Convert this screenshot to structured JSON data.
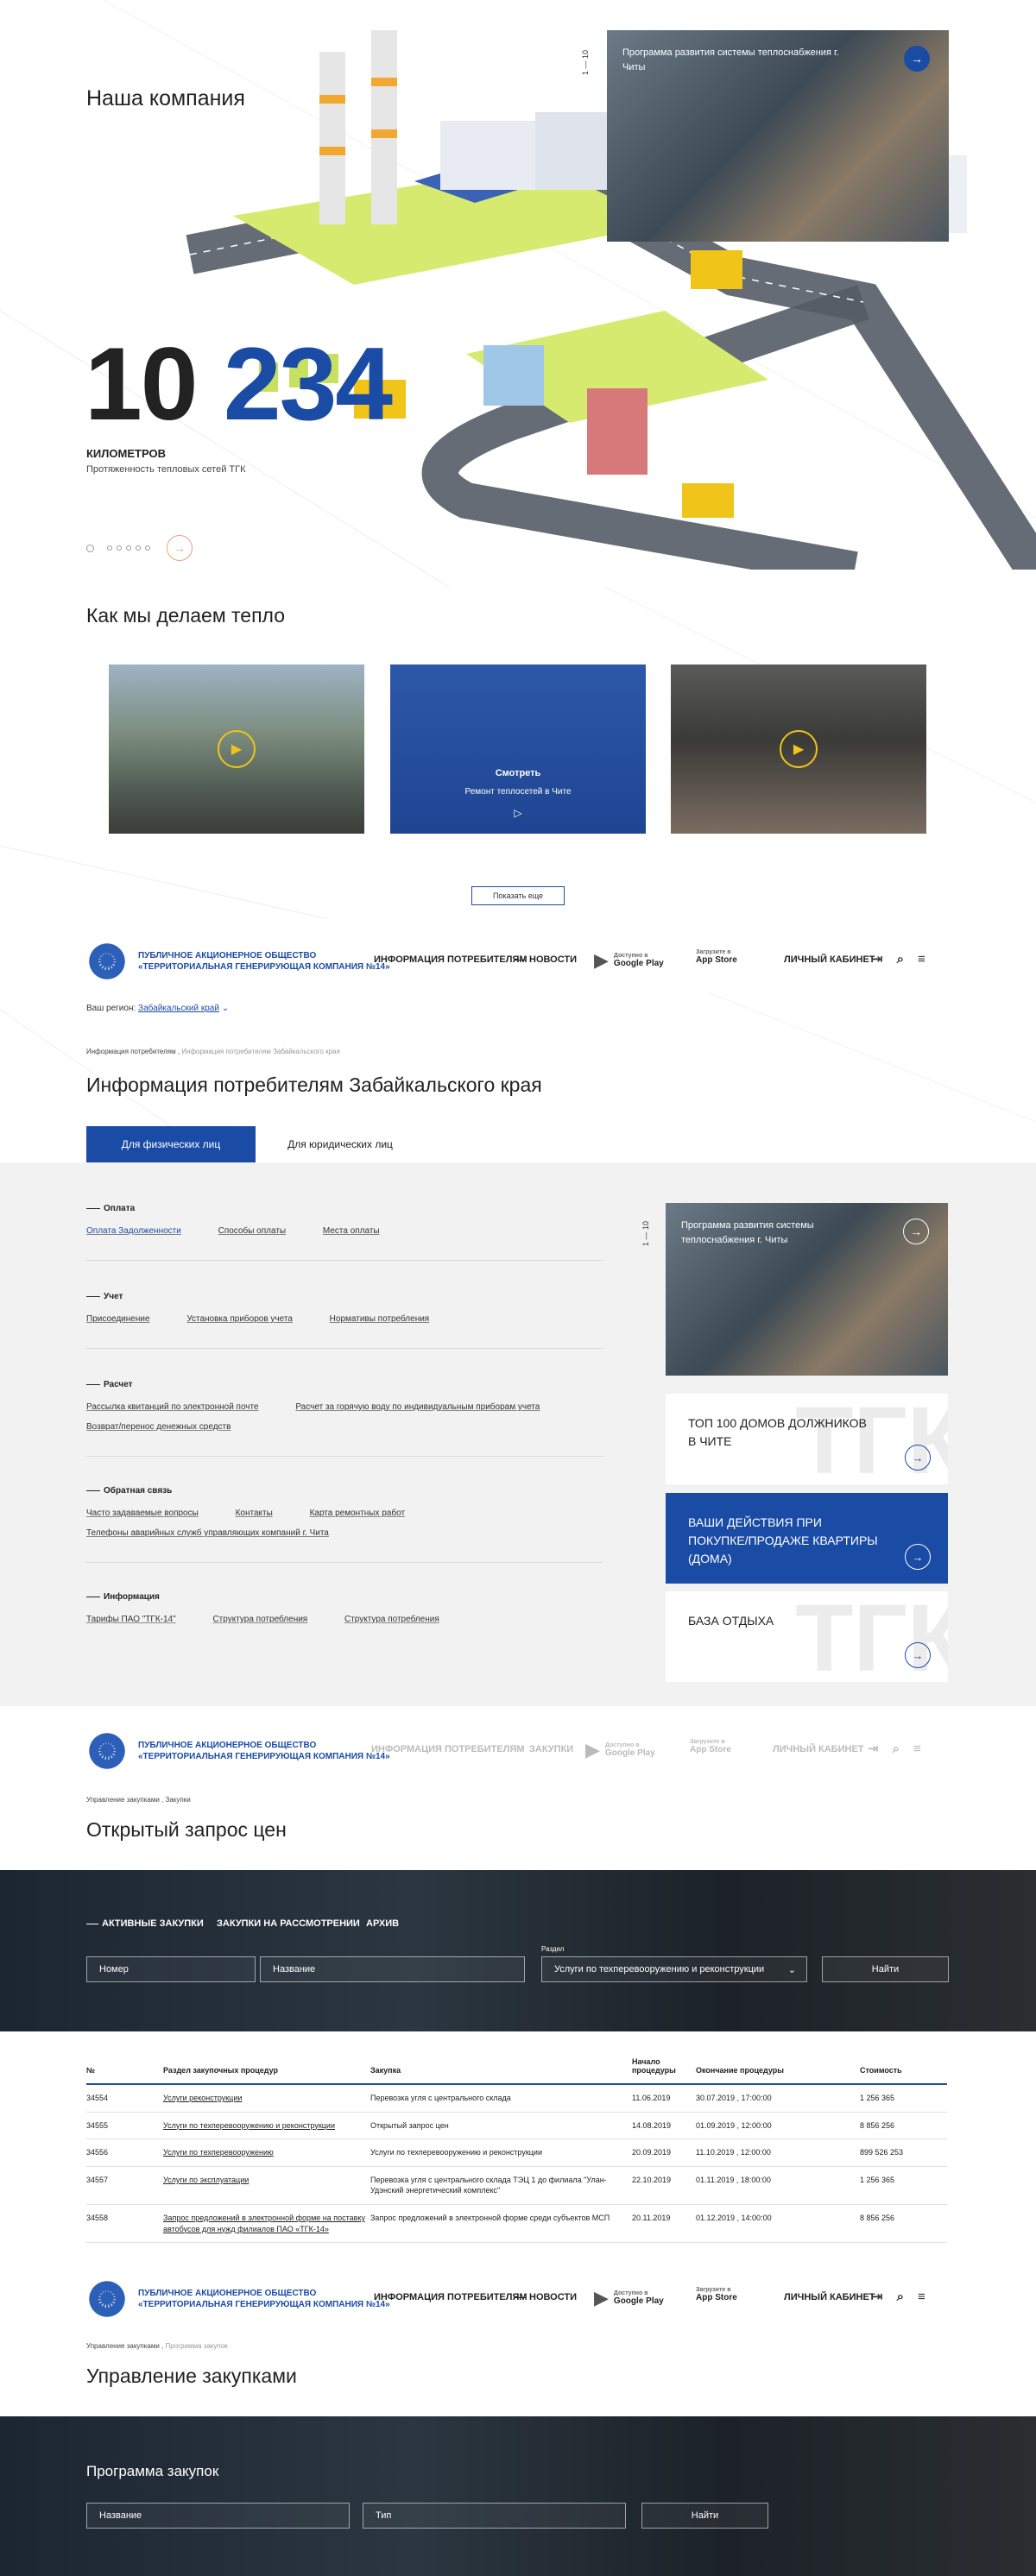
{
  "hero": {
    "title": "Наша компания",
    "number_a": "10",
    "number_b": "234",
    "unit": "КИЛОМЕТРОВ",
    "unit_sub": "Протяженность тепловых сетей ТГК",
    "pager": "1 — 10",
    "card_text": "Программа развития системы теплоснабжения г. Читы"
  },
  "heat": {
    "title": "Как мы делаем тепло",
    "video2_title": "Смотреть",
    "video2_sub": "Ремонт теплосетей в Чите",
    "more": "Показать еще"
  },
  "header": {
    "logo_line1": "ПУБЛИЧНОЕ АКЦИОНЕРНОЕ ОБЩЕСТВО",
    "logo_line2": "«ТЕРРИТОРИАЛЬНАЯ ГЕНЕРИРУЮЩАЯ КОМПАНИЯ №14»",
    "info": "ИНФОРМАЦИЯ ПОТРЕБИТЕЛЯМ",
    "news": "НОВОСТИ",
    "purchases": "ЗАКУПКИ",
    "gp_small": "Доступно в",
    "gp": "Google Play",
    "as_small": "Загрузите в",
    "as": "App Store",
    "cabinet": "ЛИЧНЫЙ КАБИНЕТ"
  },
  "consumers": {
    "region_label": "Ваш регион:",
    "region": "Забайкальский край",
    "crumb1": "Информация потребителям ,",
    "crumb2": "Информация потребителям Забайкальского края",
    "title": "Информация потребителям Забайкальского края",
    "tab_phys": "Для физических лиц",
    "tab_jur": "Для юридических лиц",
    "cat_pay": "Оплата",
    "pay_1": "Оплата Задолженности",
    "pay_2": "Способы оплаты",
    "pay_3": "Места оплаты",
    "cat_acc": "Учет",
    "acc_1": "Присоединение",
    "acc_2": "Установка приборов учета",
    "acc_3": "Нормативы потребления",
    "cat_calc": "Расчет",
    "calc_1": "Рассылка квитанций по электронной почте",
    "calc_2": "Расчет за горячую воду по индивидуальным приборам учета",
    "calc_3": "Возврат/перенос денежных средств",
    "cat_fb": "Обратная связь",
    "fb_1": "Часто задаваемые вопросы",
    "fb_2": "Контакты",
    "fb_3": "Карта ремонтных работ",
    "fb_4": "Телефоны аварийных служб управляющих компаний г. Чита",
    "cat_info": "Информация",
    "info_1": "Тарифы ПАО \"ТГК-14\"",
    "info_2": "Структура потребления",
    "info_3": "Структура потребления",
    "side_pager": "1 — 10",
    "side_photo": "Программа развития системы теплоснабжения г. Читы",
    "side_1": "ТОП 100 ДОМОВ ДОЛЖНИКОВ В ЧИТЕ",
    "side_2": "ВАШИ ДЕЙСТВИЯ ПРИ ПОКУПКЕ/ПРОДАЖЕ КВАРТИРЫ (ДОМА)",
    "side_3": "БАЗА ОТДЫХА",
    "watermark": "ТГК"
  },
  "purchases": {
    "crumb": "Управление закупками , Закупки",
    "title": "Открытый запрос цен",
    "tab_active": "АКТИВНЫЕ ЗАКУПКИ",
    "tab_review": "ЗАКУПКИ НА РАССМОТРЕНИИ",
    "tab_archive": "АРХИВ",
    "ph_number": "Номер",
    "ph_name": "Название",
    "section_label": "Раздел",
    "section_value": "Услуги по техперевооружению и реконструкции",
    "find": "Найти",
    "columns": [
      "№",
      "Раздел закупочных процедур",
      "Закупка",
      "Начало процедуры",
      "Окончание процедуры",
      "Стоимость"
    ],
    "rows": [
      [
        "34554",
        "Услуги реконструкции",
        "Перевозка угля с центрального склада",
        "11.06.2019",
        "30.07.2019 , 17:00:00",
        "1 256 365"
      ],
      [
        "34555",
        "Услуги по техперевооружению и реконструкции",
        "Открытый запрос цен",
        "14.08.2019",
        "01.09.2019 , 12:00:00",
        "8 856 256"
      ],
      [
        "34556",
        "Услуги по техперевооружению",
        "Услуги по техперевооружению и реконструкции",
        "20.09.2019",
        "11.10.2019 , 12:00:00",
        "899 526 253"
      ],
      [
        "34557",
        "Услуги по эксплуатации",
        "Перевозка угля с центрального склада ТЭЦ 1 до филиала \"Улан-Удэнский энергетический комплекс\"",
        "22.10.2019",
        "01.11.2019 , 18:00:00",
        "1 256 365"
      ],
      [
        "34558",
        "Запрос предложений в электронной форме на поставку автобусов для нужд филиалов ПАО «ТГК-14»",
        "Запрос предложений в электронной форме среди субъектов МСП",
        "20.11.2019",
        "01.12.2019 , 14:00:00",
        "8 856 256"
      ]
    ]
  },
  "management": {
    "crumb1": "Управление закупками ,",
    "crumb2": "Программа закупок",
    "title": "Управление закупками",
    "program": "Программа закупок",
    "ph_name": "Название",
    "ph_type": "Тип",
    "find": "Найти"
  },
  "colors": {
    "brand_blue": "#1a4ba5",
    "accent_yellow": "#f0c418"
  }
}
